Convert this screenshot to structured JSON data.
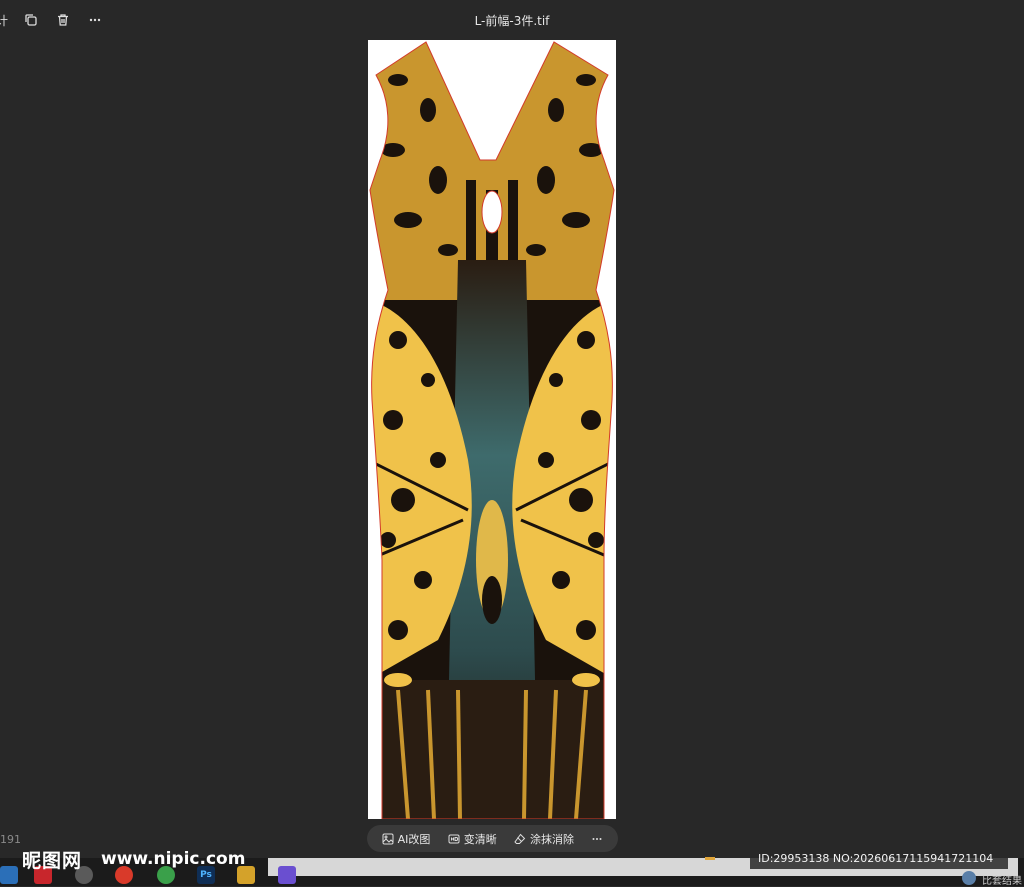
{
  "header": {
    "edit_label": "计",
    "file_title": "L-前幅-3件.tif"
  },
  "toolbar": {
    "ai_edit": "AI改图",
    "enhance": "变清晰",
    "erase": "涂抹消除"
  },
  "side_number": "191",
  "watermark": {
    "logo": "昵图网",
    "url": "www.nipic.com",
    "id": "ID:29953138 NO:20260617115941721104"
  },
  "taskbar": {
    "ps_label": "Ps",
    "tray_text": "比套结果"
  },
  "colors": {
    "background": "#282828",
    "pattern_yellow": "#f0c24a",
    "pattern_dark": "#1a120c",
    "pattern_teal": "#3e6b6c",
    "outline": "#d23a2a"
  }
}
